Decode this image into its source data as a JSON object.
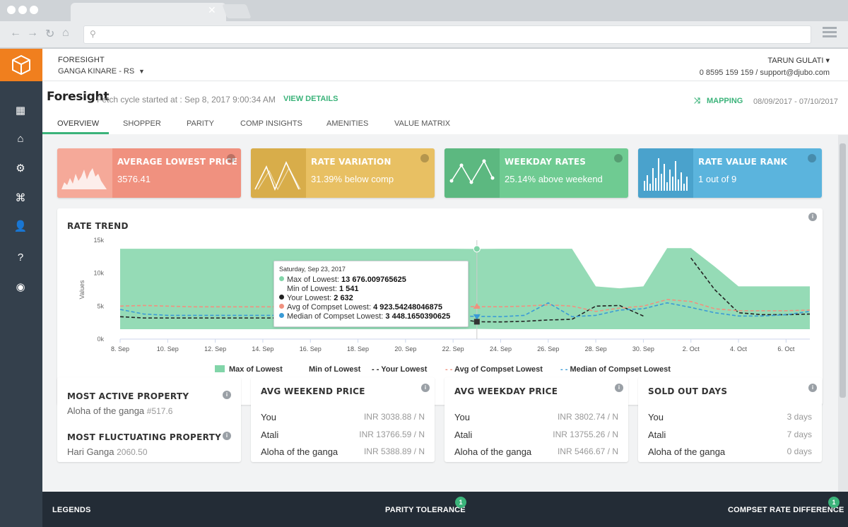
{
  "app": {
    "brand": "FORESIGHT",
    "property": "GANGA KINARE - RS",
    "user": "TARUN GULATI",
    "contact": "0 8595 159 159 / support@djubo.com"
  },
  "page": {
    "title": "Foresight",
    "fetch_text": "Fetch cycle started at : Sep 8, 2017 9:00:34 AM",
    "view_details": "VIEW DETAILS",
    "mapping": "MAPPING",
    "date_range": "08/09/2017 - 07/10/2017"
  },
  "tabs": [
    "OVERVIEW",
    "SHOPPER",
    "PARITY",
    "COMP INSIGHTS",
    "AMENITIES",
    "VALUE MATRIX"
  ],
  "kpis": [
    {
      "title": "AVERAGE LOWEST PRICE",
      "value": "3576.41",
      "color": "#f0917f",
      "art": "#f5a999"
    },
    {
      "title": "RATE VARIATION",
      "value": "31.39% below comp",
      "color": "#e8c063",
      "art": "#d8ad4a"
    },
    {
      "title": "WEEKDAY RATES",
      "value": "25.14% above weekend",
      "color": "#6fcb92",
      "art": "#5cb880"
    },
    {
      "title": "RATE VALUE RANK",
      "value": "1 out of 9",
      "color": "#5bb4dd",
      "art": "#4aa2cc"
    }
  ],
  "rate_trend": {
    "title": "RATE TREND",
    "tooltip": {
      "date": "Saturday, Sep 23, 2017",
      "rows": [
        {
          "label": "Max of Lowest:",
          "value": "13 676.009765625",
          "color": "#82d5a9"
        },
        {
          "label": "Min of Lowest:",
          "value": "1 541",
          "color": ""
        },
        {
          "label": "Your Lowest:",
          "value": "2 632",
          "color": "#222222"
        },
        {
          "label": "Avg of Compset Lowest:",
          "value": "4 923.54248046875",
          "color": "#f0917f"
        },
        {
          "label": "Median of Compset Lowest:",
          "value": "3 448.1650390625",
          "color": "#3a9bd6"
        }
      ]
    }
  },
  "chart_data": {
    "type": "area",
    "title": "RATE TREND",
    "xlabel": "",
    "ylabel": "Values",
    "ylim": [
      0,
      15000
    ],
    "y_ticks": [
      "0k",
      "5k",
      "10k",
      "15k"
    ],
    "x_ticks": [
      "8. Sep",
      "10. Sep",
      "12. Sep",
      "14. Sep",
      "16. Sep",
      "18. Sep",
      "20. Sep",
      "22. Sep",
      "24. Sep",
      "26. Sep",
      "28. Sep",
      "30. Sep",
      "2. Oct",
      "4. Oct",
      "6. Oct"
    ],
    "x": [
      "Sep 8",
      "Sep 9",
      "Sep 10",
      "Sep 11",
      "Sep 12",
      "Sep 13",
      "Sep 14",
      "Sep 15",
      "Sep 16",
      "Sep 17",
      "Sep 18",
      "Sep 19",
      "Sep 20",
      "Sep 21",
      "Sep 22",
      "Sep 23",
      "Sep 24",
      "Sep 25",
      "Sep 26",
      "Sep 27",
      "Sep 28",
      "Sep 29",
      "Sep 30",
      "Oct 1",
      "Oct 2",
      "Oct 3",
      "Oct 4",
      "Oct 5",
      "Oct 6",
      "Oct 7"
    ],
    "series": [
      {
        "name": "Max of Lowest",
        "color": "#82d5a9",
        "values": [
          13700,
          13700,
          13700,
          13700,
          13700,
          13700,
          13700,
          13700,
          13700,
          13700,
          13700,
          13700,
          13700,
          13700,
          13700,
          13676,
          13700,
          13700,
          13700,
          13700,
          8000,
          7700,
          8000,
          13800,
          13800,
          11000,
          8000,
          8000,
          8000,
          8000
        ]
      },
      {
        "name": "Min of Lowest",
        "color": "#82d5a9",
        "values": [
          1500,
          1500,
          1500,
          1500,
          1500,
          1500,
          1500,
          1500,
          1500,
          1500,
          1500,
          1500,
          1500,
          1500,
          1500,
          1541,
          1500,
          1500,
          1500,
          1500,
          1500,
          1500,
          1500,
          1500,
          1500,
          1500,
          1500,
          1500,
          1500,
          1500
        ]
      },
      {
        "name": "Your Lowest",
        "color": "#222222",
        "values": [
          3400,
          3200,
          3200,
          3200,
          3200,
          3200,
          3200,
          3200,
          3200,
          3200,
          3200,
          3200,
          3200,
          3200,
          3200,
          2632,
          2600,
          2700,
          2900,
          3000,
          5000,
          5100,
          3500,
          null,
          12300,
          7500,
          4000,
          3700,
          3700,
          3800
        ]
      },
      {
        "name": "Avg of Compset Lowest",
        "color": "#f0917f",
        "values": [
          5000,
          5100,
          5000,
          4900,
          4900,
          4900,
          4900,
          4900,
          4900,
          4900,
          4900,
          4900,
          4900,
          4900,
          4900,
          4923,
          4900,
          5000,
          5200,
          5000,
          4200,
          4700,
          5000,
          6000,
          5700,
          4600,
          4300,
          4300,
          4300,
          4400
        ]
      },
      {
        "name": "Median of Compset Lowest",
        "color": "#3a9bd6",
        "values": [
          4500,
          3800,
          3600,
          3600,
          3600,
          3600,
          3600,
          3600,
          3600,
          3600,
          3600,
          3600,
          3600,
          3600,
          3500,
          3448,
          3400,
          3600,
          5500,
          3400,
          3600,
          4400,
          4600,
          5500,
          4800,
          4000,
          3500,
          3500,
          3700,
          4200
        ]
      }
    ],
    "legend": [
      "Max of Lowest",
      "Min of Lowest",
      "Your Lowest",
      "Avg of Compset Lowest",
      "Median of Compset Lowest"
    ],
    "legend_position": "bottom",
    "grid": false
  },
  "most_active": {
    "title": "MOST ACTIVE PROPERTY",
    "name": "Aloha of the ganga",
    "rank": "#517.6"
  },
  "most_fluctuating": {
    "title": "MOST FLUCTUATING PROPERTY",
    "name": "Hari Ganga",
    "value": "2060.50"
  },
  "avg_weekend": {
    "title": "AVG WEEKEND PRICE",
    "rows": [
      {
        "label": "You",
        "value": "INR 3038.88 / N"
      },
      {
        "label": "Atali",
        "value": "INR 13766.59 / N"
      },
      {
        "label": "Aloha of the ganga",
        "value": "INR 5388.89 / N"
      }
    ]
  },
  "avg_weekday": {
    "title": "AVG WEEKDAY PRICE",
    "rows": [
      {
        "label": "You",
        "value": "INR 3802.74 / N"
      },
      {
        "label": "Atali",
        "value": "INR 13755.26 / N"
      },
      {
        "label": "Aloha of the ganga",
        "value": "INR 5466.67 / N"
      }
    ]
  },
  "sold_out": {
    "title": "SOLD OUT DAYS",
    "rows": [
      {
        "label": "You",
        "value": "3 days"
      },
      {
        "label": "Atali",
        "value": "7 days"
      },
      {
        "label": "Aloha of the ganga",
        "value": "0 days"
      }
    ]
  },
  "footer": {
    "legends": "LEGENDS",
    "parity": "PARITY TOLERANCE",
    "parity_badge": "1",
    "compset": "COMPSET RATE DIFFERENCE",
    "compset_badge": "1"
  }
}
